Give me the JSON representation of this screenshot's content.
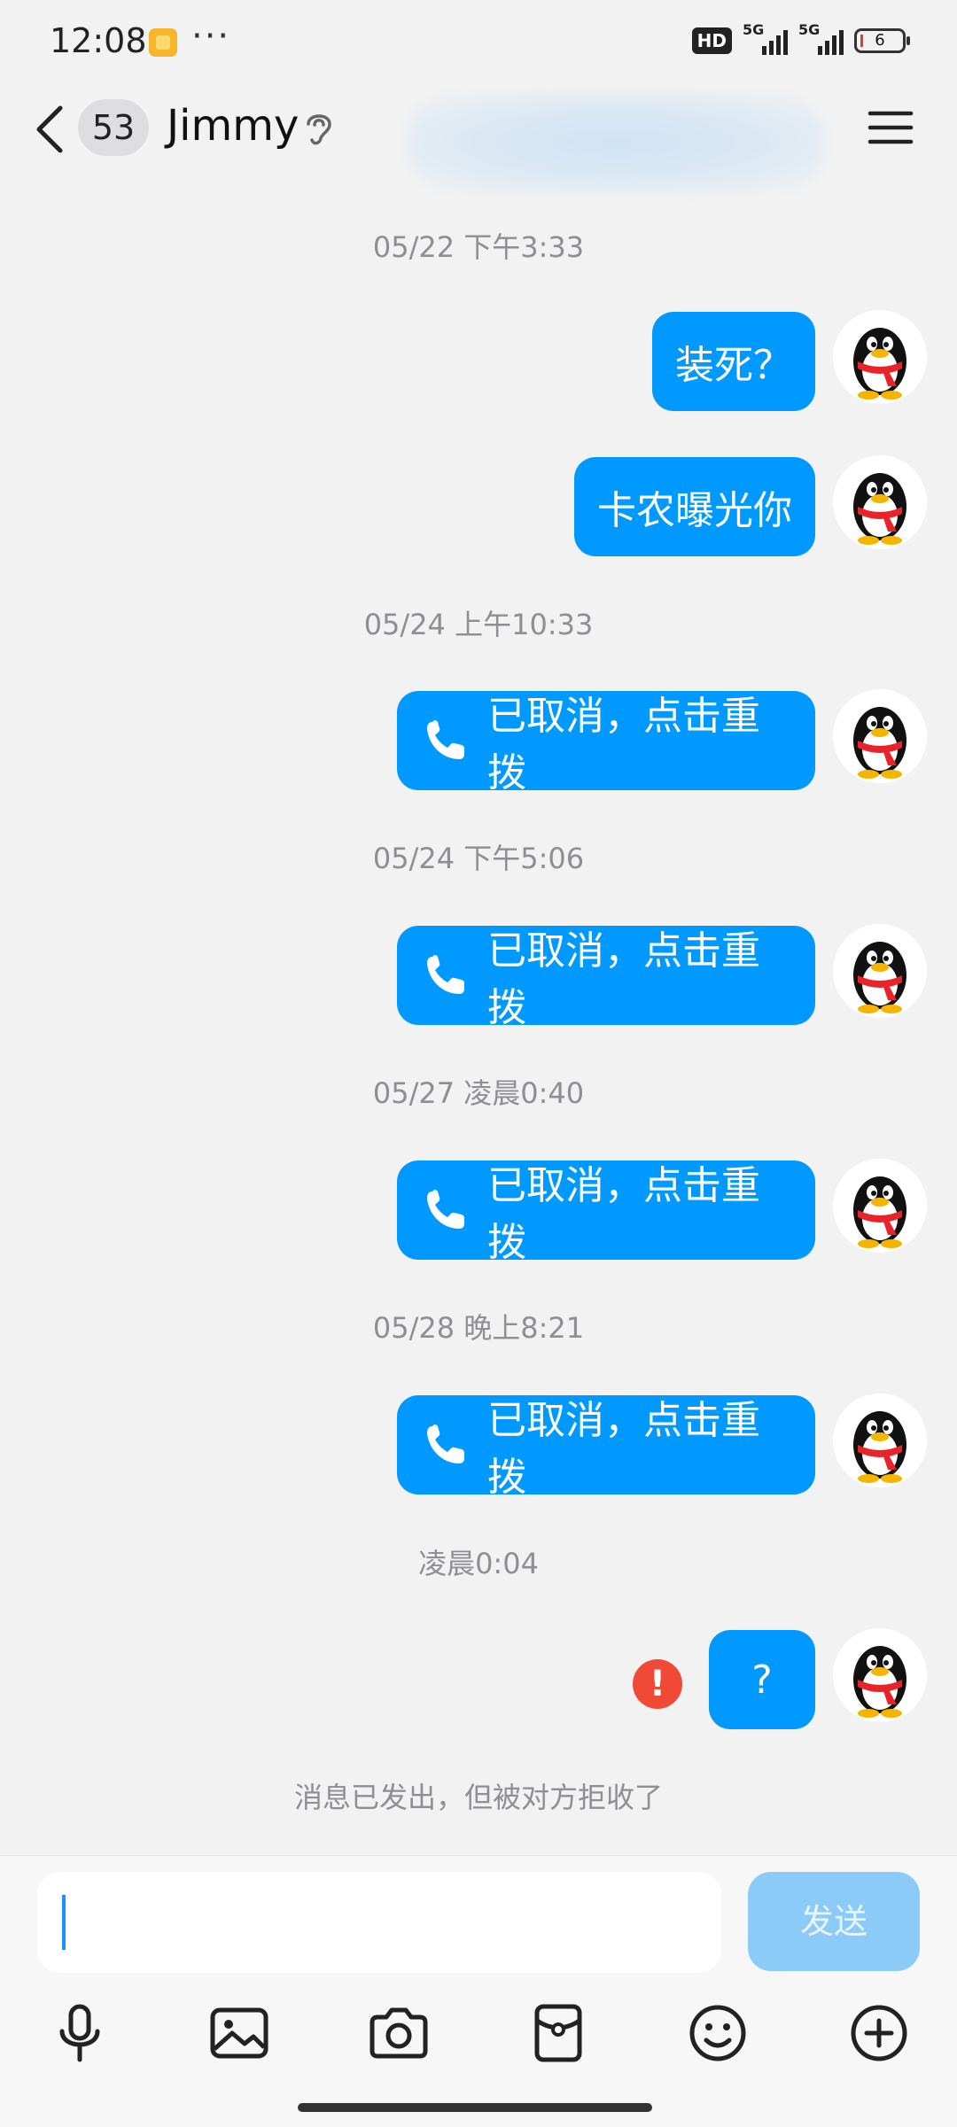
{
  "status_bar": {
    "time": "12:08",
    "more": "···",
    "hd": "HD",
    "network1": "5G",
    "network2": "5G",
    "battery": "6"
  },
  "header": {
    "unread_count": "53",
    "contact_name": "Jimmy"
  },
  "messages": [
    {
      "type": "timestamp",
      "text": "05/22 下午3:33"
    },
    {
      "type": "text",
      "text": "装死？"
    },
    {
      "type": "text",
      "text": "卡农曝光你"
    },
    {
      "type": "timestamp",
      "text": "05/24 上午10:33"
    },
    {
      "type": "call",
      "text": "已取消，点击重拨"
    },
    {
      "type": "timestamp",
      "text": "05/24 下午5:06"
    },
    {
      "type": "call",
      "text": "已取消，点击重拨"
    },
    {
      "type": "timestamp",
      "text": "05/27 凌晨0:40"
    },
    {
      "type": "call",
      "text": "已取消，点击重拨"
    },
    {
      "type": "timestamp",
      "text": "05/28 晚上8:21"
    },
    {
      "type": "call",
      "text": "已取消，点击重拨"
    },
    {
      "type": "timestamp",
      "text": "凌晨0:04"
    },
    {
      "type": "text",
      "text": "?",
      "failed": true
    }
  ],
  "system_note": "消息已发出，但被对方拒收了",
  "composer": {
    "input_value": "",
    "send_label": "发送"
  },
  "toolbar_icons": [
    "microphone-icon",
    "image-icon",
    "camera-icon",
    "red-packet-icon",
    "emoji-icon",
    "plus-icon"
  ],
  "colors": {
    "bubble": "#0099ff",
    "background": "#f2f2f3",
    "error": "#f04a36",
    "send_disabled": "#8ccaf8"
  }
}
